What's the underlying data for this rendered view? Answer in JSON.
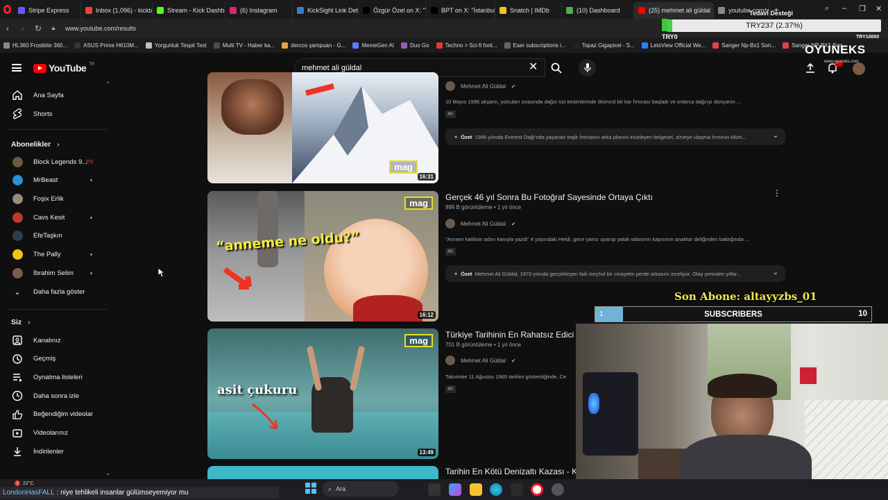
{
  "browser": {
    "tabs": [
      {
        "label": "Stripe Express",
        "color": "#635bff",
        "active": false
      },
      {
        "label": "Inbox (1,096) - kickta",
        "color": "#ea4335",
        "active": false
      },
      {
        "label": "Stream - Kick Dashbo",
        "color": "#53fc18",
        "active": false
      },
      {
        "label": "(6) Instagram",
        "color": "#d62976",
        "active": false
      },
      {
        "label": "KickSight Link Detect",
        "color": "#3a7bd5",
        "active": false
      },
      {
        "label": "Özgür Özel on X: \"Yik",
        "color": "#000000",
        "active": false
      },
      {
        "label": "BPT on X: \"İstanbul'd",
        "color": "#000000",
        "active": false
      },
      {
        "label": "Snatch | IMDb",
        "color": "#f5c518",
        "active": false
      },
      {
        "label": "(10) Dashboard",
        "color": "#4caf50",
        "active": false
      },
      {
        "label": "(25) mehmet ali güldal",
        "color": "#ff0000",
        "active": true
      },
      {
        "label": "youtube.com/watch?",
        "color": "#888888",
        "active": false
      }
    ],
    "url": "www.youtube.com/results",
    "bookmarks": [
      {
        "label": "HL360 Frostbite 360...",
        "color": "#8a8a8a"
      },
      {
        "label": "ASUS Prime H610M...",
        "color": "#333333"
      },
      {
        "label": "Yorgunluk Tespit Test",
        "color": "#c0c0c0"
      },
      {
        "label": "Multi TV - Haber ka...",
        "color": "#4d4d4d"
      },
      {
        "label": "dercos şampuan - G...",
        "color": "#e8a33c"
      },
      {
        "label": "MemeGen AI",
        "color": "#5a7cff"
      },
      {
        "label": "Duo Go",
        "color": "#9b59b6"
      },
      {
        "label": "Techno > Sci-fi font...",
        "color": "#e53935"
      },
      {
        "label": "Eser subscriptions i...",
        "color": "#666666"
      },
      {
        "label": "Topaz Gigapixel - S...",
        "color": "#222222"
      },
      {
        "label": "LetsView Official We...",
        "color": "#2e7df6"
      },
      {
        "label": "Sanger Np-Bx1 Son...",
        "color": "#d44"
      },
      {
        "label": "Sanger NP-BX1 Son...",
        "color": "#d44"
      }
    ]
  },
  "youtube": {
    "logo_text": "YouTube",
    "region": "TR",
    "search_query": "mehmet ali güldal",
    "sidebar": {
      "main": [
        {
          "label": "Ana Sayfa",
          "icon": "home-icon"
        },
        {
          "label": "Shorts",
          "icon": "shorts-icon"
        }
      ],
      "subscriptions_header": "Abonelikler",
      "subscriptions": [
        {
          "label": "Block Legends 9...",
          "color": "#6d5a3a",
          "live": true,
          "dot": false
        },
        {
          "label": "MrBeast",
          "color": "#2b8fd6",
          "live": false,
          "dot": true
        },
        {
          "label": "Foşix Erlik",
          "color": "#9a8a7a",
          "live": false,
          "dot": false
        },
        {
          "label": "Cavs Kesit",
          "color": "#c0392b",
          "live": false,
          "dot": true
        },
        {
          "label": "EfeTaşkın",
          "color": "#2c3e50",
          "live": false,
          "dot": false
        },
        {
          "label": "The Pally",
          "color": "#f1c40f",
          "live": false,
          "dot": true
        },
        {
          "label": "İbrahim Selim",
          "color": "#7f5a48",
          "live": false,
          "dot": true
        }
      ],
      "show_more": "Daha fazla göster",
      "you_header": "Siz",
      "you_items": [
        {
          "label": "Kanalınız",
          "icon": "channel-icon"
        },
        {
          "label": "Geçmiş",
          "icon": "history-icon"
        },
        {
          "label": "Oynatma listeleri",
          "icon": "playlist-icon"
        },
        {
          "label": "Daha sonra izle",
          "icon": "watch-later-icon"
        },
        {
          "label": "Beğendiğim videolar",
          "icon": "like-icon"
        },
        {
          "label": "Videolarınız",
          "icon": "your-videos-icon"
        },
        {
          "label": "İndirilenler",
          "icon": "download-icon"
        }
      ]
    },
    "results": [
      {
        "title": "",
        "views": "",
        "channel": "Mehmet Ali Güldal",
        "description": "10 Mayıs 1996 akşamı, yolcuları sırasında dağın üst kesimlerinde ölümcül bir kar fırtınası başladı ve onlarca dağcıyı dünyanın ...",
        "badge": "4K",
        "summary_label": "Özet",
        "summary": "1996 yılında Everest Dağı'nda yaşanan trajik fırtınanın arka planını inceleyen belgesel, zirveye ulaşma hırsının ölüm...",
        "duration": "16:31",
        "thumb_tag": "mag"
      },
      {
        "title": "Gerçek 46 yıl Sonra Bu Fotoğraf Sayesinde Ortaya Çıktı",
        "views": "999 B görüntüleme • 1 yıl önce",
        "channel": "Mehmet Ali Güldal",
        "description": "\"Annem katilinin adını kanıyla yazdı\" 4 yaşındaki Heidi, gece yarısı uyanıp yatak odasının kapısının anahtar deliğinden baktığında ...",
        "badge": "4K",
        "summary_label": "Özet",
        "summary": "Mehmet Ali Güldal, 1970 yılında gerçekleşen faili meçhul bir cinayetin perde arkasını inceliyor. Olay yerinden yıllar...",
        "duration": "16:12",
        "thumb_tag": "mag",
        "thumb_text": "“anneme ne oldu?”"
      },
      {
        "title": "Türkiye Tarihinin En Rahatsız Edici G",
        "views": "701 B görüntüleme • 1 yıl önce",
        "channel": "Mehmet Ali Güldal",
        "description": "Takvimler 11 Ağustos 1965 tarihini gösterdiğinde, Ce",
        "badge": "4K",
        "duration": "13:49",
        "thumb_tag": "mag",
        "thumb_text": "asit çukuru"
      },
      {
        "title": "Tarihin En Kötü Denizaltı Kazası - Ku"
      }
    ]
  },
  "overlay": {
    "donation_title": "Tedavi Desteği",
    "donation_amount": "TRY237 (2.37%)",
    "donation_progress": 0.0237,
    "donation_min": "TRY0",
    "donation_max": "TRY10000",
    "brand": "OYUNEKS",
    "brand_sub": "www.oyuneks.com",
    "last_sub": "Son Abone: altayyzbs_01",
    "sub_current": "1",
    "sub_label": "SUBSCRIBERS",
    "sub_goal": "10",
    "sub_progress": 0.1
  },
  "taskbar": {
    "weather": "22°C",
    "ticker_user": "LondonHasFALL",
    "ticker_msg": ": niye tehlikeli insanlar gülümseyemiyor mu",
    "search_placeholder": "Ara"
  }
}
